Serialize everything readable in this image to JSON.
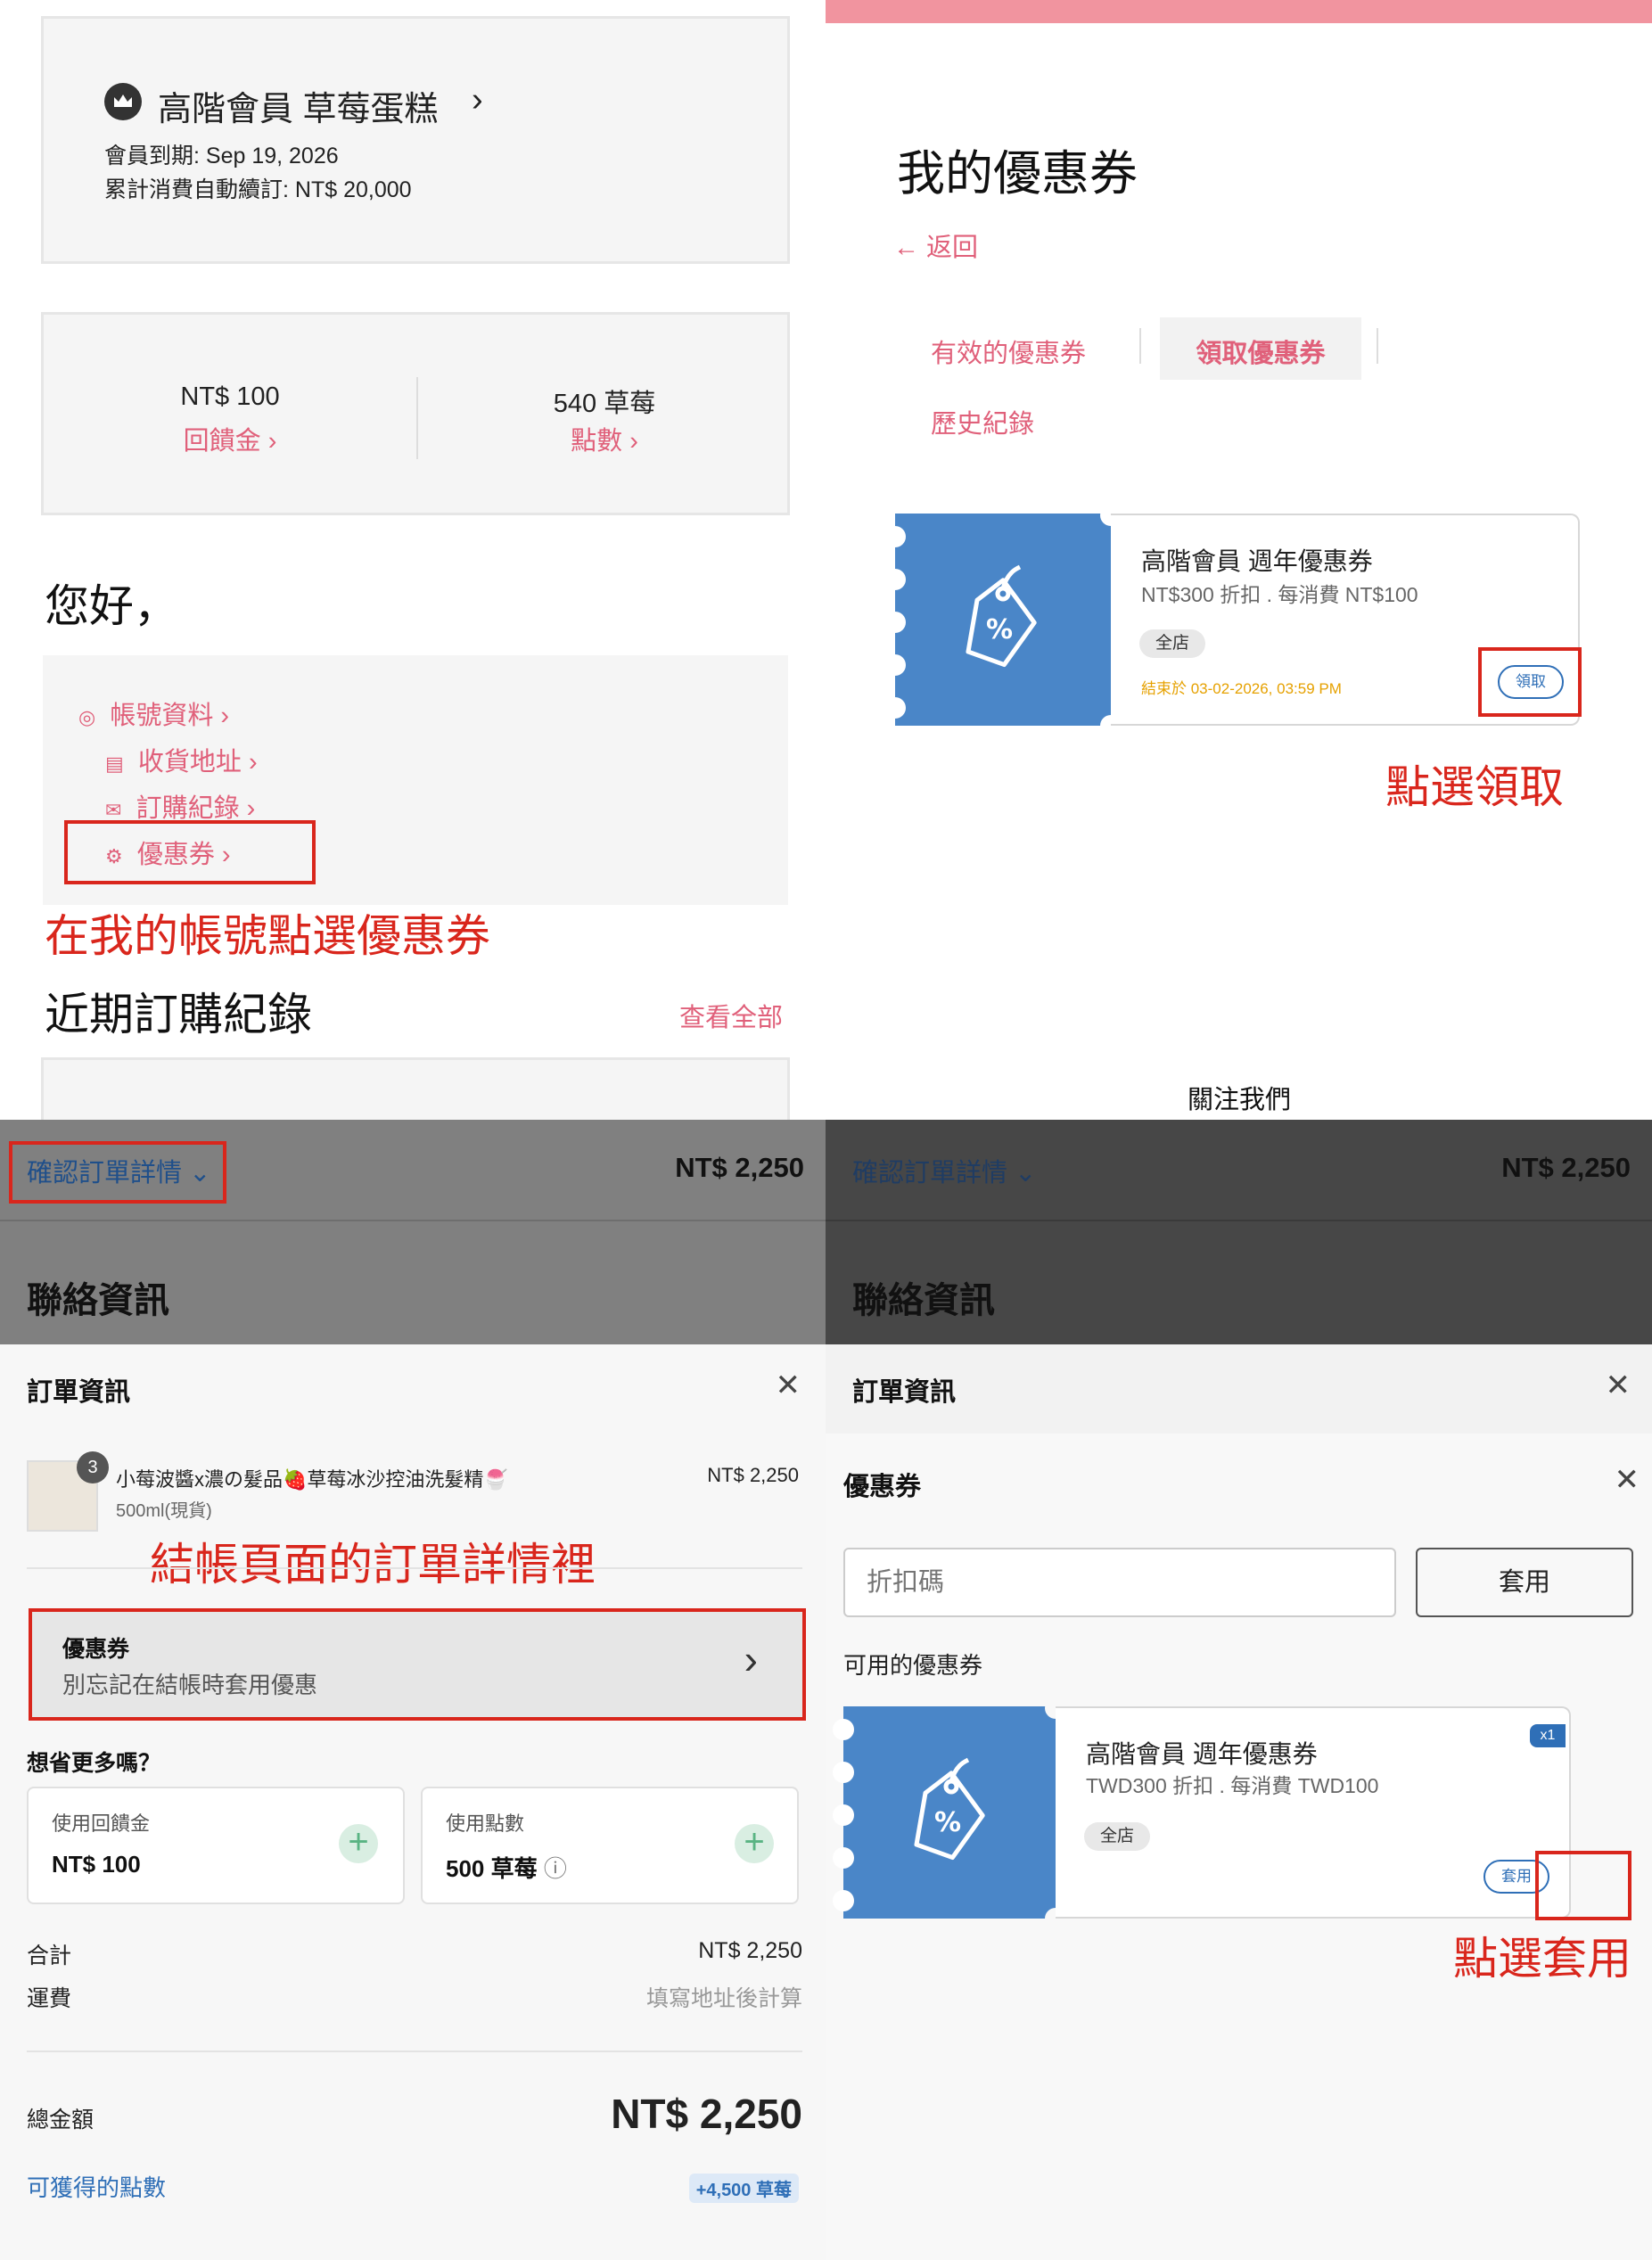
{
  "panel_account": {
    "member_tier": "高階會員 草莓蛋糕",
    "member_expiry": "會員到期: Sep 19, 2026",
    "auto_renew": "累計消費自動續訂: NT$ 20,000",
    "rebate_value": "NT$ 100",
    "rebate_label": "回饋金",
    "points_value": "540 草莓",
    "points_label": "點數",
    "greeting": "您好，",
    "menu": [
      {
        "label": "帳號資料",
        "icon": "user-circle-icon"
      },
      {
        "label": "收貨地址",
        "icon": "address-icon"
      },
      {
        "label": "訂購紀錄",
        "icon": "mail-icon"
      },
      {
        "label": "優惠券",
        "icon": "coupon-icon"
      }
    ],
    "annotation": "在我的帳號點選優惠券",
    "recent_orders_title": "近期訂購紀錄",
    "view_all": "查看全部"
  },
  "panel_coupons": {
    "title": "我的優惠券",
    "back": "← 返回",
    "tabs": [
      "有效的優惠券",
      "領取優惠券",
      "歷史紀錄"
    ],
    "active_tab": "領取優惠券",
    "coupon": {
      "name": "高階會員 週年優惠券",
      "desc": "NT$300 折扣 . 每消費 NT$100",
      "scope": "全店",
      "ends": "結束於 03-02-2026, 03:59 PM",
      "button": "領取"
    },
    "annotation": "點選領取",
    "follow_us": "關注我們"
  },
  "panel_checkout": {
    "toggle_label": "確認訂單詳情",
    "total_top": "NT$ 2,250",
    "contact_title": "聯絡資訊",
    "sheet_title": "訂單資訊",
    "product": {
      "qty": "3",
      "name": "小莓波醬x濃の髮品🍓草莓冰沙控油洗髮精🍧",
      "variant": "500ml(現貨)",
      "price": "NT$ 2,250"
    },
    "annotation": "結帳頁面的訂單詳情裡",
    "coupon_row_title": "優惠券",
    "coupon_row_sub": "別忘記在結帳時套用優惠",
    "save_more": "想省更多嗎？",
    "use_rebate_label": "使用回饋金",
    "use_rebate_value": "NT$ 100",
    "use_points_label": "使用點數",
    "use_points_value": "500 草莓",
    "subtotal_label": "合計",
    "subtotal_value": "NT$ 2,250",
    "shipping_label": "運費",
    "shipping_value": "填寫地址後計算",
    "grand_total_label": "總金額",
    "grand_total_value": "NT$ 2,250",
    "earn_points_label": "可獲得的點數",
    "earn_points_value": "+4,500 草莓"
  },
  "panel_apply": {
    "toggle_label": "確認訂單詳情",
    "total_top": "NT$ 2,250",
    "contact_title": "聯絡資訊",
    "sheet_title": "訂單資訊",
    "coupon_sheet_title": "優惠券",
    "code_placeholder": "折扣碼",
    "apply_label": "套用",
    "available_title": "可用的優惠券",
    "coupon": {
      "name": "高階會員 週年優惠券",
      "desc": "TWD300 折扣 . 每消費 TWD100",
      "scope": "全店",
      "count": "x1",
      "button": "套用"
    },
    "annotation": "點選套用"
  },
  "colors": {
    "accent_pink": "#e0607a",
    "ticket_blue": "#4a86c8",
    "annotation_red": "#d9261c",
    "link_blue": "#2f6fb7"
  }
}
